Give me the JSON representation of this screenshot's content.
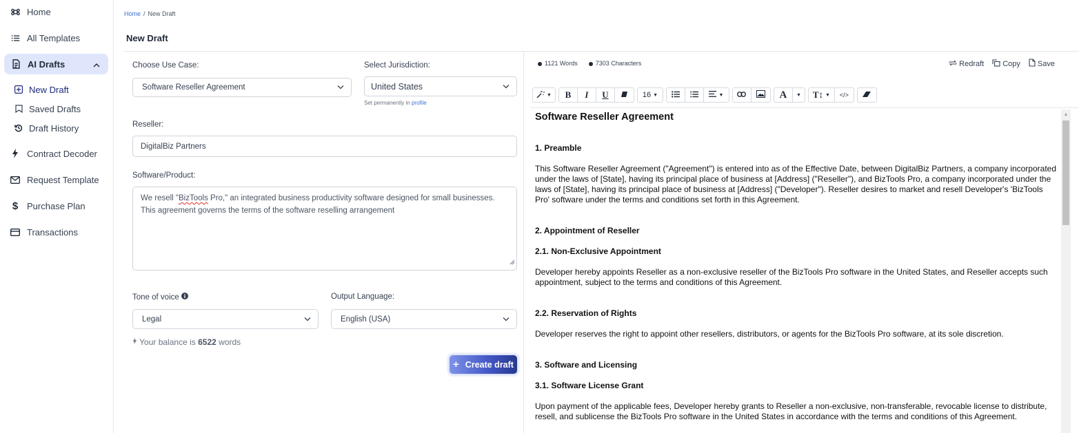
{
  "sidebar": {
    "items": [
      {
        "label": "Home",
        "icon": "command-icon"
      },
      {
        "label": "All Templates",
        "icon": "list-icon"
      },
      {
        "label": "AI Drafts",
        "icon": "document-icon",
        "expanded": true
      },
      {
        "label": "Contract Decoder",
        "icon": "bolt-icon"
      },
      {
        "label": "Request Template",
        "icon": "mail-icon"
      },
      {
        "label": "Purchase Plan",
        "icon": "dollar-icon"
      },
      {
        "label": "Transactions",
        "icon": "card-icon"
      }
    ],
    "sub_items": [
      {
        "label": "New Draft",
        "icon": "plus-square-icon"
      },
      {
        "label": "Saved Drafts",
        "icon": "bookmark-icon"
      },
      {
        "label": "Draft History",
        "icon": "history-icon"
      }
    ]
  },
  "breadcrumb": {
    "home": "Home",
    "sep": "/",
    "current": "New Draft"
  },
  "page_title": "New Draft",
  "form": {
    "use_case": {
      "label": "Choose Use Case:",
      "value": "Software Reseller Agreement"
    },
    "jurisdiction": {
      "label": "Select Jurisdiction:",
      "value": "United States",
      "hint_prefix": "Set permanently in",
      "hint_link": "profile"
    },
    "reseller": {
      "label": "Reseller:",
      "value": "DigitalBiz Partners"
    },
    "product": {
      "label": "Software/Product:",
      "value_pre": "We resell \"",
      "value_flagged": "BizTools",
      "value_post": " Pro,\" an integrated business productivity software designed for small businesses. This agreement governs the terms of the software reselling arrangement"
    },
    "tone": {
      "label": "Tone of voice",
      "value": "Legal"
    },
    "language": {
      "label": "Output Language:",
      "value": "English (USA)"
    },
    "balance": {
      "prefix": "Your balance is",
      "amount": "6522",
      "suffix": "words"
    },
    "create_label": "Create draft"
  },
  "editor": {
    "words": "1121 Words",
    "characters": "7303 Characters",
    "actions": {
      "redraft": "Redraft",
      "copy": "Copy",
      "save": "Save"
    },
    "toolbar": {
      "font_size": "16"
    },
    "document": {
      "title": "Software Reseller Agreement",
      "s1": "1. Preamble",
      "p1": "This Software Reseller Agreement (\"Agreement\") is entered into as of the Effective Date, between DigitalBiz Partners, a company incorporated under the laws of [State], having its principal place of business at [Address] (\"Reseller\"), and BizTools Pro, a company incorporated under the laws of [State], having its principal place of business at [Address] (\"Developer\"). Reseller desires to market and resell Developer's 'BizTools Pro' software under the terms and conditions set forth in this Agreement.",
      "s2": "2. Appointment of Reseller",
      "s21": "2.1. Non-Exclusive Appointment",
      "p21": "Developer hereby appoints Reseller as a non-exclusive reseller of the BizTools Pro software in the United States, and Reseller accepts such appointment, subject to the terms and conditions of this Agreement.",
      "s22": "2.2. Reservation of Rights",
      "p22": "Developer reserves the right to appoint other resellers, distributors, or agents for the BizTools Pro software, at its sole discretion.",
      "s3": "3. Software and Licensing",
      "s31": "3.1. Software License Grant",
      "p31": "Upon payment of the applicable fees, Developer hereby grants to Reseller a non-exclusive, non-transferable, revocable license to distribute, resell, and sublicense the BizTools Pro software in the United States in accordance with the terms and conditions of this Agreement."
    }
  },
  "colors": {
    "accent": "#26388f",
    "active_bg": "#dfe5fb",
    "link": "#3b6fd8"
  }
}
